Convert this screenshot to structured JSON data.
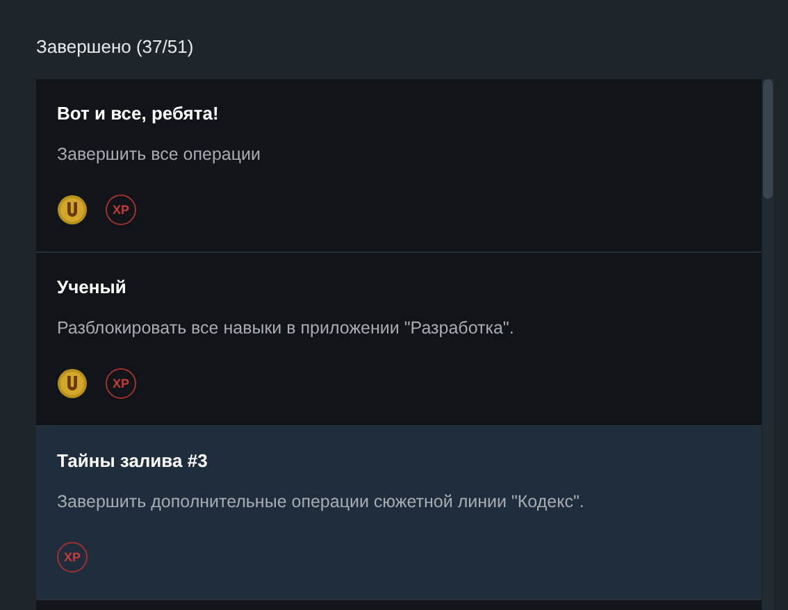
{
  "header": "Завершено (37/51)",
  "achievements": [
    {
      "title": "Вот и все, ребята!",
      "description": "Завершить все операции",
      "selected": false,
      "rewards": [
        {
          "kind": "u"
        },
        {
          "kind": "xp",
          "label": "XP"
        }
      ]
    },
    {
      "title": "Ученый",
      "description": "Разблокировать все навыки в приложении \"Разработка\".",
      "selected": false,
      "rewards": [
        {
          "kind": "u"
        },
        {
          "kind": "xp",
          "label": "XP"
        }
      ]
    },
    {
      "title": "Тайны залива #3",
      "description": "Завершить дополнительные операции сюжетной линии \"Кодекс\".",
      "selected": true,
      "rewards": [
        {
          "kind": "xp",
          "label": "XP"
        }
      ]
    }
  ]
}
